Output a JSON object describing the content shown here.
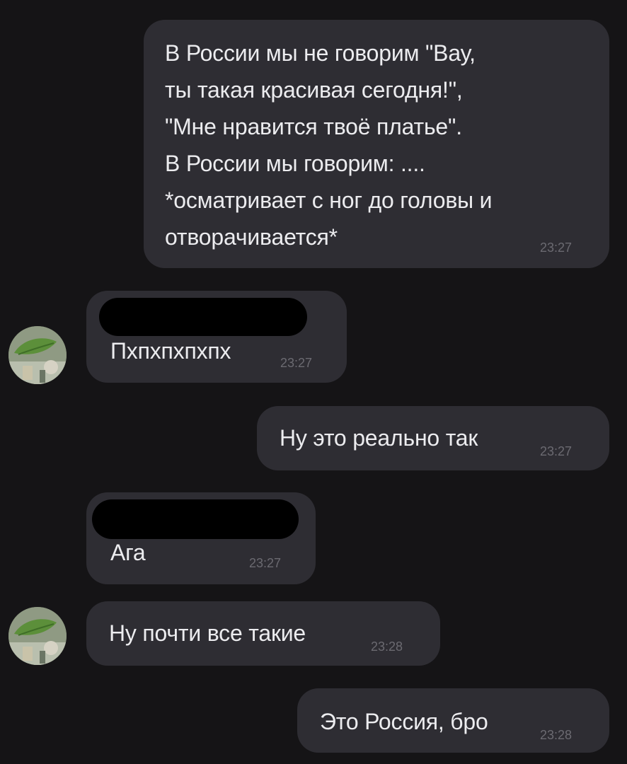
{
  "messages": [
    {
      "id": "m1",
      "direction": "outgoing",
      "lines": [
        "В России мы не говорим \"Вау,",
        "ты такая красивая сегодня!\",",
        "\"Мне нравится твоё платье\".",
        "В России мы говорим: ....",
        "*осматривает с ног до головы и",
        "отворачивается*"
      ],
      "time": "23:27"
    },
    {
      "id": "m2",
      "direction": "incoming",
      "sender_redacted": true,
      "text": "Пхпхпхпхпх",
      "time": "23:27"
    },
    {
      "id": "m3",
      "direction": "outgoing",
      "text": "Ну это реально так",
      "time": "23:27"
    },
    {
      "id": "m4",
      "direction": "incoming",
      "sender_redacted": true,
      "text": "Ага",
      "time": "23:27"
    },
    {
      "id": "m5",
      "direction": "incoming",
      "text": "Ну почти все такие",
      "time": "23:28"
    },
    {
      "id": "m6",
      "direction": "outgoing",
      "text": "Это Россия, бро",
      "time": "23:28"
    }
  ],
  "colors": {
    "background": "#151416",
    "bubble": "#2e2d33",
    "text": "#ececef",
    "timestamp": "#6b6a71",
    "redaction": "#000000"
  }
}
